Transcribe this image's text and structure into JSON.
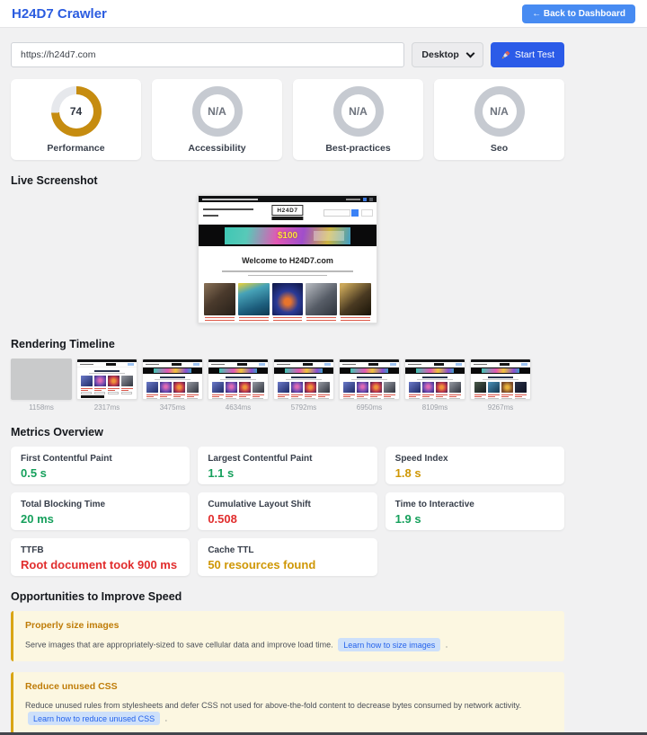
{
  "header": {
    "title": "H24D7 Crawler",
    "back_button": "← Back to Dashboard"
  },
  "test_bar": {
    "url_value": "https://h24d7.com",
    "device_selected": "Desktop",
    "start_button": "Start Test"
  },
  "scores": {
    "items": [
      {
        "label": "Performance",
        "value": "74",
        "percent": 74,
        "ring_color": "#c68c10",
        "track_color": "#e6e8ec",
        "value_color": "#2f3540"
      },
      {
        "label": "Accessibility",
        "value": "N/A",
        "percent": 100,
        "ring_color": "#c6cad1",
        "track_color": "#c6cad1",
        "value_color": "#6d737d"
      },
      {
        "label": "Best-practices",
        "value": "N/A",
        "percent": 100,
        "ring_color": "#c6cad1",
        "track_color": "#c6cad1",
        "value_color": "#6d737d"
      },
      {
        "label": "Seo",
        "value": "N/A",
        "percent": 100,
        "ring_color": "#c6cad1",
        "track_color": "#c6cad1",
        "value_color": "#6d737d"
      }
    ]
  },
  "live_screenshot": {
    "heading": "Live Screenshot",
    "site_logo": "H24D7",
    "site_banner_text": "$100",
    "site_welcome": "Welcome to H24D7.com"
  },
  "timeline": {
    "heading": "Rendering Timeline",
    "frames": [
      {
        "time": "1158ms",
        "variant": "blank"
      },
      {
        "time": "2317ms",
        "variant": "partial"
      },
      {
        "time": "3475ms",
        "variant": "full"
      },
      {
        "time": "4634ms",
        "variant": "full"
      },
      {
        "time": "5792ms",
        "variant": "full"
      },
      {
        "time": "6950ms",
        "variant": "full"
      },
      {
        "time": "8109ms",
        "variant": "full"
      },
      {
        "time": "9267ms",
        "variant": "full_alt"
      }
    ]
  },
  "metrics": {
    "heading": "Metrics Overview",
    "items": [
      {
        "label": "First Contentful Paint",
        "value": "0.5 s",
        "status": "good"
      },
      {
        "label": "Largest Contentful Paint",
        "value": "1.1 s",
        "status": "good"
      },
      {
        "label": "Speed Index",
        "value": "1.8 s",
        "status": "warn"
      },
      {
        "label": "Total Blocking Time",
        "value": "20 ms",
        "status": "good"
      },
      {
        "label": "Cumulative Layout Shift",
        "value": "0.508",
        "status": "bad"
      },
      {
        "label": "Time to Interactive",
        "value": "1.9 s",
        "status": "good"
      },
      {
        "label": "TTFB",
        "value": "Root document took 900 ms",
        "status": "bad"
      },
      {
        "label": "Cache TTL",
        "value": "50 resources found",
        "status": "warn"
      }
    ]
  },
  "opportunities": {
    "heading": "Opportunities to Improve Speed",
    "items": [
      {
        "title": "Properly size images",
        "description": "Serve images that are appropriately-sized to save cellular data and improve load time.",
        "link_label": "Learn how to size images",
        "suffix": "."
      },
      {
        "title": "Reduce unused CSS",
        "description": "Reduce unused rules from stylesheets and defer CSS not used for above-the-fold content to decrease bytes consumed by network activity.",
        "link_label": "Learn how to reduce unused CSS",
        "suffix": "."
      }
    ]
  },
  "status_colors": {
    "good": "#16a05c",
    "warn": "#cf9705",
    "bad": "#e12d2d"
  }
}
